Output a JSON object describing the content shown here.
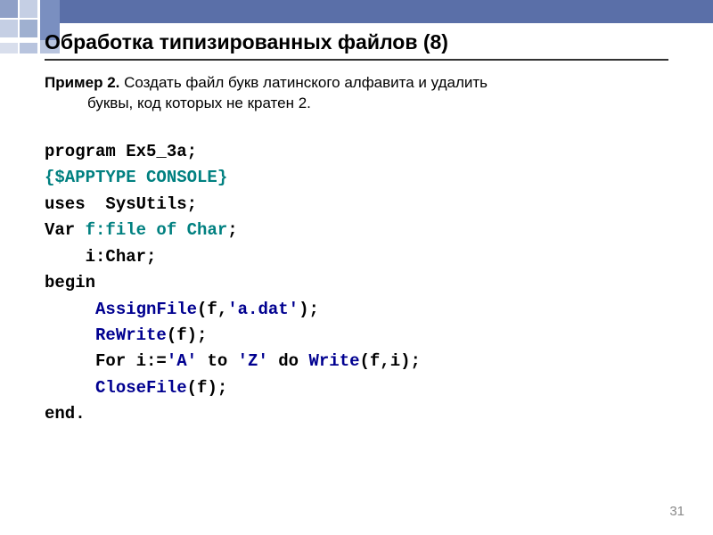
{
  "title": "Обработка типизированных файлов (8)",
  "example": {
    "label": "Пример 2.",
    "line1": " Создать файл букв латинского алфавита и удалить",
    "line2": "буквы, код которых не кратен 2."
  },
  "code": {
    "l01a": "program",
    "l01b": " Ex5_3a;",
    "l02": "{$APPTYPE CONSOLE}",
    "l03a": "uses",
    "l03b": "  SysUtils;",
    "l04a": "Var",
    "l04b": " f:file of Char",
    "l04c": ";",
    "l05": "    i:Char;",
    "l06": "begin",
    "l07a": "     AssignFile",
    "l07b": "(f,",
    "l07c": "'a.dat'",
    "l07d": ");",
    "l08a": "     ReWrite",
    "l08b": "(f);",
    "l09a": "     For",
    "l09b": " i:=",
    "l09c": "'A'",
    "l09d": " to ",
    "l09e": "'Z'",
    "l09f": " do ",
    "l09g": "Write",
    "l09h": "(f,i);",
    "l10a": "     CloseFile",
    "l10b": "(f);",
    "l11": "end."
  },
  "pageNumber": "31"
}
